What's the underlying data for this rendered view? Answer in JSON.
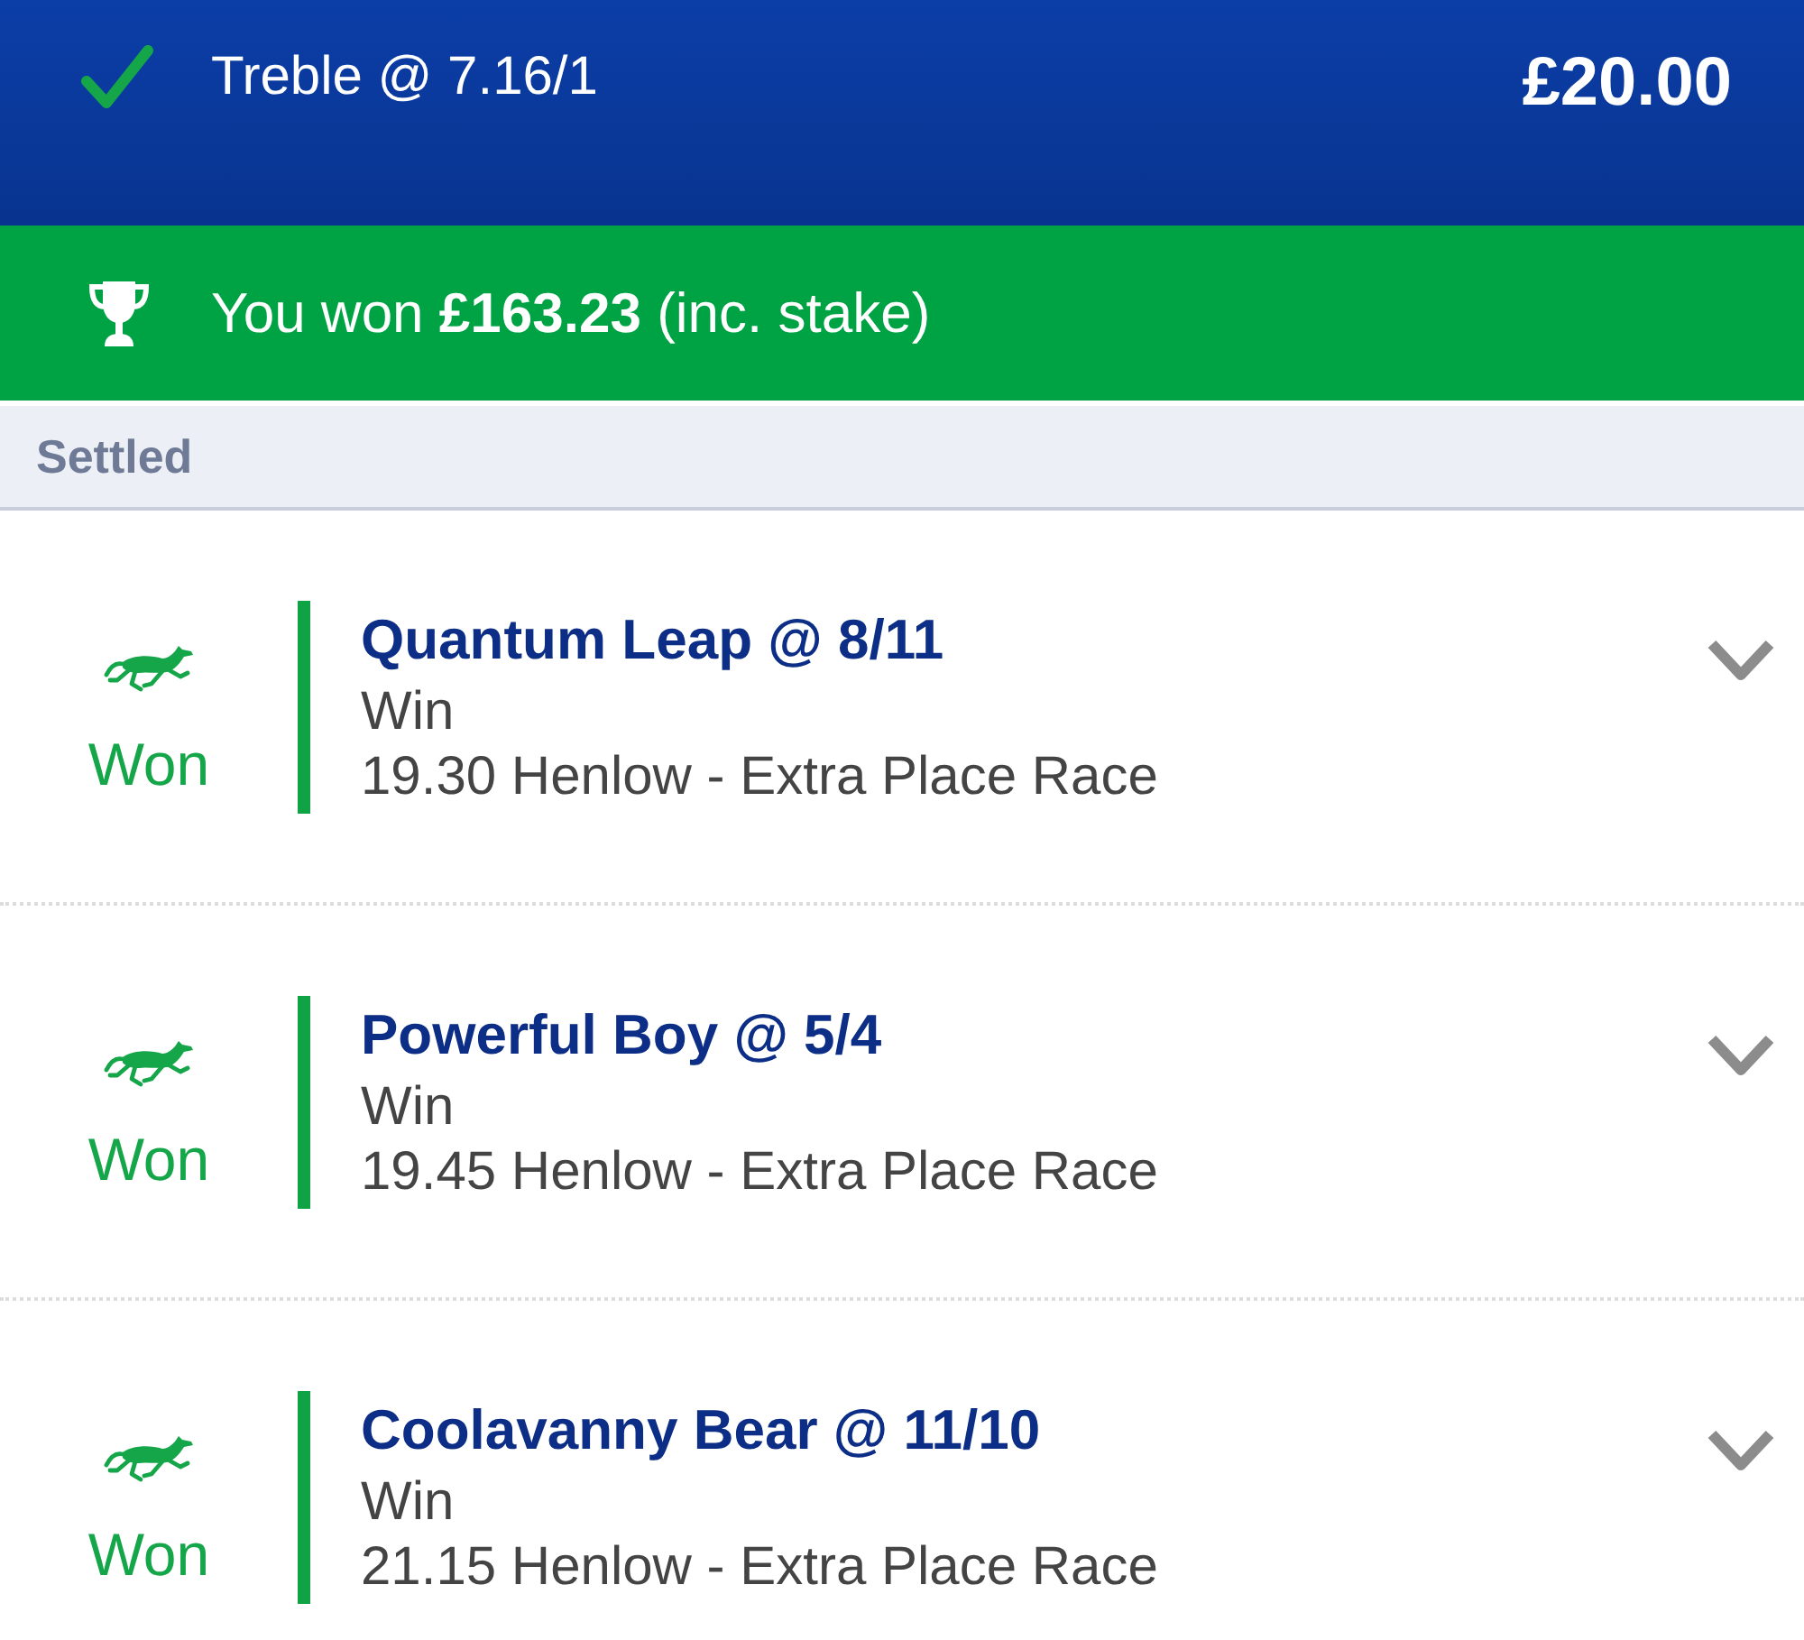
{
  "header": {
    "title": "Treble @ 7.16/1",
    "stake": "£20.00"
  },
  "result_banner": {
    "text": "You won **£163.23** (inc. stake)"
  },
  "section": {
    "label": "Settled"
  },
  "selections": [
    {
      "result": "Won",
      "name": "Quantum Leap @ 8/11",
      "market": "Win",
      "event": "19.30 Henlow - Extra Place Race",
      "expanded": false
    },
    {
      "result": "Won",
      "name": "Powerful Boy @ 5/4",
      "market": "Win",
      "event": "19.45 Henlow - Extra Place Race",
      "expanded": false
    },
    {
      "result": "Won",
      "name": "Coolavanny Bear @ 11/10",
      "market": "Win",
      "event": "21.15 Henlow - Extra Place Race",
      "expanded": false
    }
  ]
}
